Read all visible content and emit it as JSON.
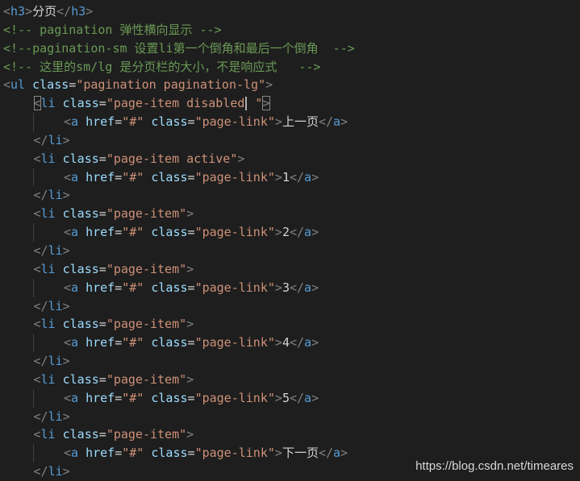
{
  "editor": {
    "lines": [
      {
        "indent": 0,
        "guide": false,
        "tokens": [
          {
            "t": "punct",
            "v": "<"
          },
          {
            "t": "tag",
            "v": "h3"
          },
          {
            "t": "punct",
            "v": ">"
          },
          {
            "t": "text",
            "v": "分页"
          },
          {
            "t": "punct",
            "v": "</"
          },
          {
            "t": "tag",
            "v": "h3"
          },
          {
            "t": "punct",
            "v": ">"
          }
        ]
      },
      {
        "indent": 0,
        "guide": false,
        "tokens": [
          {
            "t": "comment",
            "v": "<!-- pagination 弹性横向显示 -->"
          }
        ]
      },
      {
        "indent": 0,
        "guide": false,
        "tokens": [
          {
            "t": "comment",
            "v": "<!--pagination-sm 设置li第一个倒角和最后一个倒角  -->"
          }
        ]
      },
      {
        "indent": 0,
        "guide": false,
        "tokens": [
          {
            "t": "comment",
            "v": "<!-- 这里的sm/lg 是分页栏的大小，不是响应式   -->"
          }
        ]
      },
      {
        "indent": 0,
        "guide": false,
        "tokens": [
          {
            "t": "punct",
            "v": "<"
          },
          {
            "t": "tag",
            "v": "ul"
          },
          {
            "t": "text",
            "v": " "
          },
          {
            "t": "attr",
            "v": "class"
          },
          {
            "t": "eq",
            "v": "="
          },
          {
            "t": "str",
            "v": "\"pagination pagination-lg\""
          },
          {
            "t": "punct",
            "v": ">"
          }
        ]
      },
      {
        "indent": 1,
        "guide": false,
        "tokens": [
          {
            "t": "punct",
            "v": "<",
            "match": true
          },
          {
            "t": "tag",
            "v": "li"
          },
          {
            "t": "text",
            "v": " "
          },
          {
            "t": "attr",
            "v": "class"
          },
          {
            "t": "eq",
            "v": "="
          },
          {
            "t": "str",
            "v": "\"page-item disabled"
          },
          {
            "t": "caret",
            "v": ""
          },
          {
            "t": "str",
            "v": " \""
          },
          {
            "t": "punct",
            "v": ">",
            "match": true
          }
        ]
      },
      {
        "indent": 2,
        "guide": true,
        "tokens": [
          {
            "t": "punct",
            "v": "<"
          },
          {
            "t": "tag",
            "v": "a"
          },
          {
            "t": "text",
            "v": " "
          },
          {
            "t": "attr",
            "v": "href"
          },
          {
            "t": "eq",
            "v": "="
          },
          {
            "t": "str",
            "v": "\"#\""
          },
          {
            "t": "text",
            "v": " "
          },
          {
            "t": "attr",
            "v": "class"
          },
          {
            "t": "eq",
            "v": "="
          },
          {
            "t": "str",
            "v": "\"page-link\""
          },
          {
            "t": "punct",
            "v": ">"
          },
          {
            "t": "text",
            "v": "上一页"
          },
          {
            "t": "punct",
            "v": "</"
          },
          {
            "t": "tag",
            "v": "a"
          },
          {
            "t": "punct",
            "v": ">"
          }
        ]
      },
      {
        "indent": 1,
        "guide": false,
        "tokens": [
          {
            "t": "punct",
            "v": "</"
          },
          {
            "t": "tag",
            "v": "li"
          },
          {
            "t": "punct",
            "v": ">"
          }
        ]
      },
      {
        "indent": 1,
        "guide": false,
        "tokens": [
          {
            "t": "punct",
            "v": "<"
          },
          {
            "t": "tag",
            "v": "li"
          },
          {
            "t": "text",
            "v": " "
          },
          {
            "t": "attr",
            "v": "class"
          },
          {
            "t": "eq",
            "v": "="
          },
          {
            "t": "str",
            "v": "\"page-item active\""
          },
          {
            "t": "punct",
            "v": ">"
          }
        ]
      },
      {
        "indent": 2,
        "guide": true,
        "tokens": [
          {
            "t": "punct",
            "v": "<"
          },
          {
            "t": "tag",
            "v": "a"
          },
          {
            "t": "text",
            "v": " "
          },
          {
            "t": "attr",
            "v": "href"
          },
          {
            "t": "eq",
            "v": "="
          },
          {
            "t": "str",
            "v": "\"#\""
          },
          {
            "t": "text",
            "v": " "
          },
          {
            "t": "attr",
            "v": "class"
          },
          {
            "t": "eq",
            "v": "="
          },
          {
            "t": "str",
            "v": "\"page-link\""
          },
          {
            "t": "punct",
            "v": ">"
          },
          {
            "t": "text",
            "v": "1"
          },
          {
            "t": "punct",
            "v": "</"
          },
          {
            "t": "tag",
            "v": "a"
          },
          {
            "t": "punct",
            "v": ">"
          }
        ]
      },
      {
        "indent": 1,
        "guide": false,
        "tokens": [
          {
            "t": "punct",
            "v": "</"
          },
          {
            "t": "tag",
            "v": "li"
          },
          {
            "t": "punct",
            "v": ">"
          }
        ]
      },
      {
        "indent": 1,
        "guide": false,
        "tokens": [
          {
            "t": "punct",
            "v": "<"
          },
          {
            "t": "tag",
            "v": "li"
          },
          {
            "t": "text",
            "v": " "
          },
          {
            "t": "attr",
            "v": "class"
          },
          {
            "t": "eq",
            "v": "="
          },
          {
            "t": "str",
            "v": "\"page-item\""
          },
          {
            "t": "punct",
            "v": ">"
          }
        ]
      },
      {
        "indent": 2,
        "guide": true,
        "tokens": [
          {
            "t": "punct",
            "v": "<"
          },
          {
            "t": "tag",
            "v": "a"
          },
          {
            "t": "text",
            "v": " "
          },
          {
            "t": "attr",
            "v": "href"
          },
          {
            "t": "eq",
            "v": "="
          },
          {
            "t": "str",
            "v": "\"#\""
          },
          {
            "t": "text",
            "v": " "
          },
          {
            "t": "attr",
            "v": "class"
          },
          {
            "t": "eq",
            "v": "="
          },
          {
            "t": "str",
            "v": "\"page-link\""
          },
          {
            "t": "punct",
            "v": ">"
          },
          {
            "t": "text",
            "v": "2"
          },
          {
            "t": "punct",
            "v": "</"
          },
          {
            "t": "tag",
            "v": "a"
          },
          {
            "t": "punct",
            "v": ">"
          }
        ]
      },
      {
        "indent": 1,
        "guide": false,
        "tokens": [
          {
            "t": "punct",
            "v": "</"
          },
          {
            "t": "tag",
            "v": "li"
          },
          {
            "t": "punct",
            "v": ">"
          }
        ]
      },
      {
        "indent": 1,
        "guide": false,
        "tokens": [
          {
            "t": "punct",
            "v": "<"
          },
          {
            "t": "tag",
            "v": "li"
          },
          {
            "t": "text",
            "v": " "
          },
          {
            "t": "attr",
            "v": "class"
          },
          {
            "t": "eq",
            "v": "="
          },
          {
            "t": "str",
            "v": "\"page-item\""
          },
          {
            "t": "punct",
            "v": ">"
          }
        ]
      },
      {
        "indent": 2,
        "guide": true,
        "tokens": [
          {
            "t": "punct",
            "v": "<"
          },
          {
            "t": "tag",
            "v": "a"
          },
          {
            "t": "text",
            "v": " "
          },
          {
            "t": "attr",
            "v": "href"
          },
          {
            "t": "eq",
            "v": "="
          },
          {
            "t": "str",
            "v": "\"#\""
          },
          {
            "t": "text",
            "v": " "
          },
          {
            "t": "attr",
            "v": "class"
          },
          {
            "t": "eq",
            "v": "="
          },
          {
            "t": "str",
            "v": "\"page-link\""
          },
          {
            "t": "punct",
            "v": ">"
          },
          {
            "t": "text",
            "v": "3"
          },
          {
            "t": "punct",
            "v": "</"
          },
          {
            "t": "tag",
            "v": "a"
          },
          {
            "t": "punct",
            "v": ">"
          }
        ]
      },
      {
        "indent": 1,
        "guide": false,
        "tokens": [
          {
            "t": "punct",
            "v": "</"
          },
          {
            "t": "tag",
            "v": "li"
          },
          {
            "t": "punct",
            "v": ">"
          }
        ]
      },
      {
        "indent": 1,
        "guide": false,
        "tokens": [
          {
            "t": "punct",
            "v": "<"
          },
          {
            "t": "tag",
            "v": "li"
          },
          {
            "t": "text",
            "v": " "
          },
          {
            "t": "attr",
            "v": "class"
          },
          {
            "t": "eq",
            "v": "="
          },
          {
            "t": "str",
            "v": "\"page-item\""
          },
          {
            "t": "punct",
            "v": ">"
          }
        ]
      },
      {
        "indent": 2,
        "guide": true,
        "tokens": [
          {
            "t": "punct",
            "v": "<"
          },
          {
            "t": "tag",
            "v": "a"
          },
          {
            "t": "text",
            "v": " "
          },
          {
            "t": "attr",
            "v": "href"
          },
          {
            "t": "eq",
            "v": "="
          },
          {
            "t": "str",
            "v": "\"#\""
          },
          {
            "t": "text",
            "v": " "
          },
          {
            "t": "attr",
            "v": "class"
          },
          {
            "t": "eq",
            "v": "="
          },
          {
            "t": "str",
            "v": "\"page-link\""
          },
          {
            "t": "punct",
            "v": ">"
          },
          {
            "t": "text",
            "v": "4"
          },
          {
            "t": "punct",
            "v": "</"
          },
          {
            "t": "tag",
            "v": "a"
          },
          {
            "t": "punct",
            "v": ">"
          }
        ]
      },
      {
        "indent": 1,
        "guide": false,
        "tokens": [
          {
            "t": "punct",
            "v": "</"
          },
          {
            "t": "tag",
            "v": "li"
          },
          {
            "t": "punct",
            "v": ">"
          }
        ]
      },
      {
        "indent": 1,
        "guide": false,
        "tokens": [
          {
            "t": "punct",
            "v": "<"
          },
          {
            "t": "tag",
            "v": "li"
          },
          {
            "t": "text",
            "v": " "
          },
          {
            "t": "attr",
            "v": "class"
          },
          {
            "t": "eq",
            "v": "="
          },
          {
            "t": "str",
            "v": "\"page-item\""
          },
          {
            "t": "punct",
            "v": ">"
          }
        ]
      },
      {
        "indent": 2,
        "guide": true,
        "tokens": [
          {
            "t": "punct",
            "v": "<"
          },
          {
            "t": "tag",
            "v": "a"
          },
          {
            "t": "text",
            "v": " "
          },
          {
            "t": "attr",
            "v": "href"
          },
          {
            "t": "eq",
            "v": "="
          },
          {
            "t": "str",
            "v": "\"#\""
          },
          {
            "t": "text",
            "v": " "
          },
          {
            "t": "attr",
            "v": "class"
          },
          {
            "t": "eq",
            "v": "="
          },
          {
            "t": "str",
            "v": "\"page-link\""
          },
          {
            "t": "punct",
            "v": ">"
          },
          {
            "t": "text",
            "v": "5"
          },
          {
            "t": "punct",
            "v": "</"
          },
          {
            "t": "tag",
            "v": "a"
          },
          {
            "t": "punct",
            "v": ">"
          }
        ]
      },
      {
        "indent": 1,
        "guide": false,
        "tokens": [
          {
            "t": "punct",
            "v": "</"
          },
          {
            "t": "tag",
            "v": "li"
          },
          {
            "t": "punct",
            "v": ">"
          }
        ]
      },
      {
        "indent": 1,
        "guide": false,
        "tokens": [
          {
            "t": "punct",
            "v": "<"
          },
          {
            "t": "tag",
            "v": "li"
          },
          {
            "t": "text",
            "v": " "
          },
          {
            "t": "attr",
            "v": "class"
          },
          {
            "t": "eq",
            "v": "="
          },
          {
            "t": "str",
            "v": "\"page-item\""
          },
          {
            "t": "punct",
            "v": ">"
          }
        ]
      },
      {
        "indent": 2,
        "guide": true,
        "tokens": [
          {
            "t": "punct",
            "v": "<"
          },
          {
            "t": "tag",
            "v": "a"
          },
          {
            "t": "text",
            "v": " "
          },
          {
            "t": "attr",
            "v": "href"
          },
          {
            "t": "eq",
            "v": "="
          },
          {
            "t": "str",
            "v": "\"#\""
          },
          {
            "t": "text",
            "v": " "
          },
          {
            "t": "attr",
            "v": "class"
          },
          {
            "t": "eq",
            "v": "="
          },
          {
            "t": "str",
            "v": "\"page-link\""
          },
          {
            "t": "punct",
            "v": ">"
          },
          {
            "t": "text",
            "v": "下一页"
          },
          {
            "t": "punct",
            "v": "</"
          },
          {
            "t": "tag",
            "v": "a"
          },
          {
            "t": "punct",
            "v": ">"
          }
        ]
      },
      {
        "indent": 1,
        "guide": false,
        "tokens": [
          {
            "t": "punct",
            "v": "</"
          },
          {
            "t": "tag",
            "v": "li"
          },
          {
            "t": "punct",
            "v": ">"
          }
        ]
      }
    ]
  },
  "watermark": {
    "text": "https://blog.csdn.net/timeares"
  },
  "colors": {
    "background": "#1e1e1e",
    "tag": "#569cd6",
    "punctuation": "#808080",
    "attribute": "#9cdcfe",
    "string": "#ce9178",
    "text": "#d4d4d4",
    "comment": "#6a9955"
  }
}
